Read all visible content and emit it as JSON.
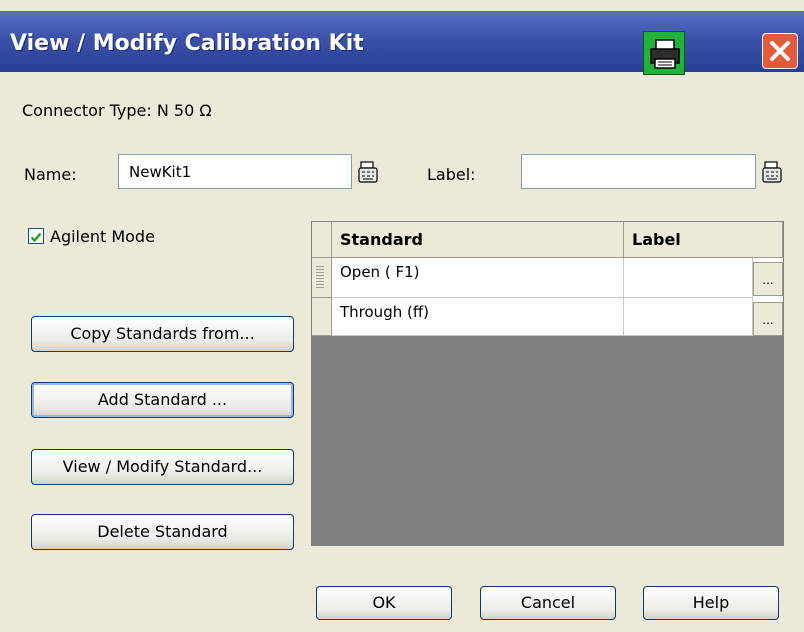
{
  "window": {
    "title": "View / Modify Calibration Kit"
  },
  "connector": {
    "text": "Connector Type: N 50 Ω"
  },
  "name": {
    "label": "Name:",
    "value": "NewKit1"
  },
  "labelfield": {
    "label": "Label:",
    "value": ""
  },
  "agilent_mode": {
    "label": "Agilent Mode",
    "checked": true
  },
  "buttons": {
    "copy": "Copy Standards from...",
    "add": "Add Standard ...",
    "view": "View / Modify Standard...",
    "delete": "Delete Standard"
  },
  "table": {
    "columns": [
      "Standard",
      "Label"
    ],
    "rows": [
      {
        "standard": "Open (  F1)",
        "label": "",
        "button": "..."
      },
      {
        "standard": "Through (ff)",
        "label": "",
        "button": "..."
      }
    ]
  },
  "footer": {
    "ok": "OK",
    "cancel": "Cancel",
    "help": "Help"
  },
  "colors": {
    "titlebar": "#3c52aa",
    "close": "#e35a3c",
    "print": "#22b23a",
    "face": "#ece9d8"
  },
  "icons": {
    "print": "printer-icon",
    "close": "close-icon",
    "picker": "keyboard-icon",
    "check": "check-icon"
  }
}
